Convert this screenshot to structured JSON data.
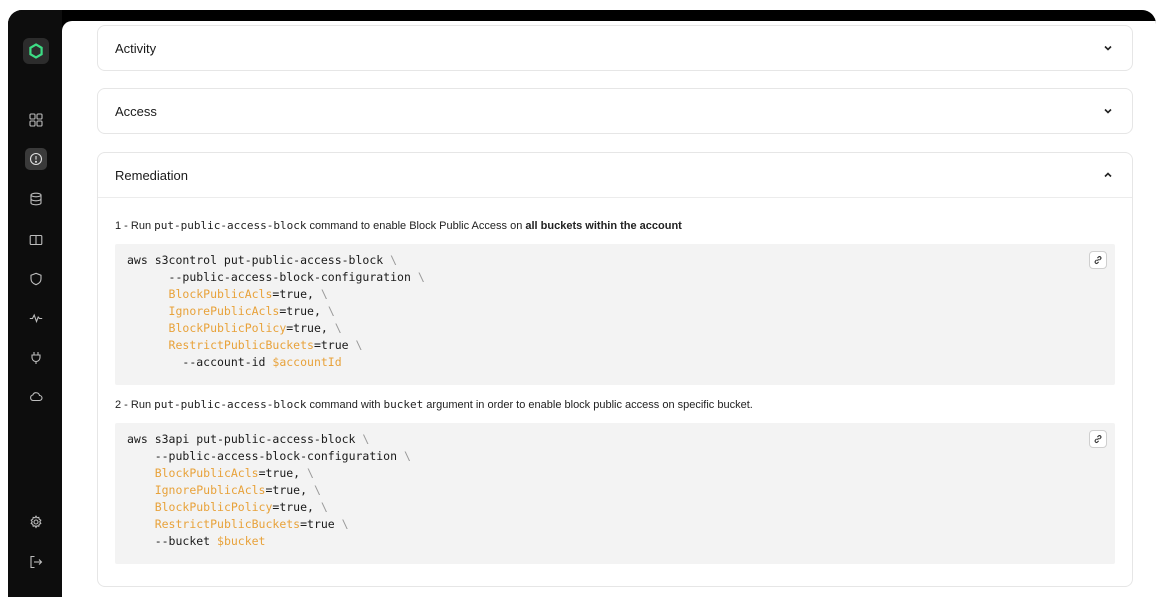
{
  "sections": {
    "activity": {
      "title": "Activity"
    },
    "access": {
      "title": "Access"
    },
    "remediation": {
      "title": "Remediation"
    }
  },
  "remediation": {
    "step1": {
      "prefix": "1 - Run ",
      "command": "put-public-access-block",
      "middle": " command to enable Block Public Access on ",
      "bold": "all buckets within the account"
    },
    "step2": {
      "prefix": "2 - Run ",
      "command": "put-public-access-block",
      "middle": " command with ",
      "arg": "bucket",
      "suffix": " argument in order to enable block public access on specific bucket."
    },
    "code1": {
      "line1": "aws s3control put-public-access-block",
      "line2": "--public-access-block-configuration",
      "k1": "BlockPublicAcls",
      "v1": "=true,",
      "k2": "IgnorePublicAcls",
      "v2": "=true,",
      "k3": "BlockPublicPolicy",
      "v3": "=true,",
      "k4": "RestrictPublicBuckets",
      "v4": "=true",
      "line7a": "--account-id ",
      "line7b": "$accountId"
    },
    "code2": {
      "line1": "aws s3api put-public-access-block",
      "line2": "--public-access-block-configuration",
      "k1": "BlockPublicAcls",
      "v1": "=true,",
      "k2": "IgnorePublicAcls",
      "v2": "=true,",
      "k3": "BlockPublicPolicy",
      "v3": "=true,",
      "k4": "RestrictPublicBuckets",
      "v4": "=true",
      "line7a": "--bucket ",
      "line7b": "$bucket"
    },
    "backslash": "\\"
  },
  "sidebar_icons": [
    "dashboard-icon",
    "alert-icon",
    "database-icon",
    "book-icon",
    "shield-icon",
    "activity-icon",
    "plug-icon",
    "cloud-icon",
    "settings-icon",
    "logout-icon"
  ],
  "colors": {
    "accent": "#3ddc84",
    "code_key": "#e8a23a",
    "code_bg": "#f3f3f3"
  }
}
